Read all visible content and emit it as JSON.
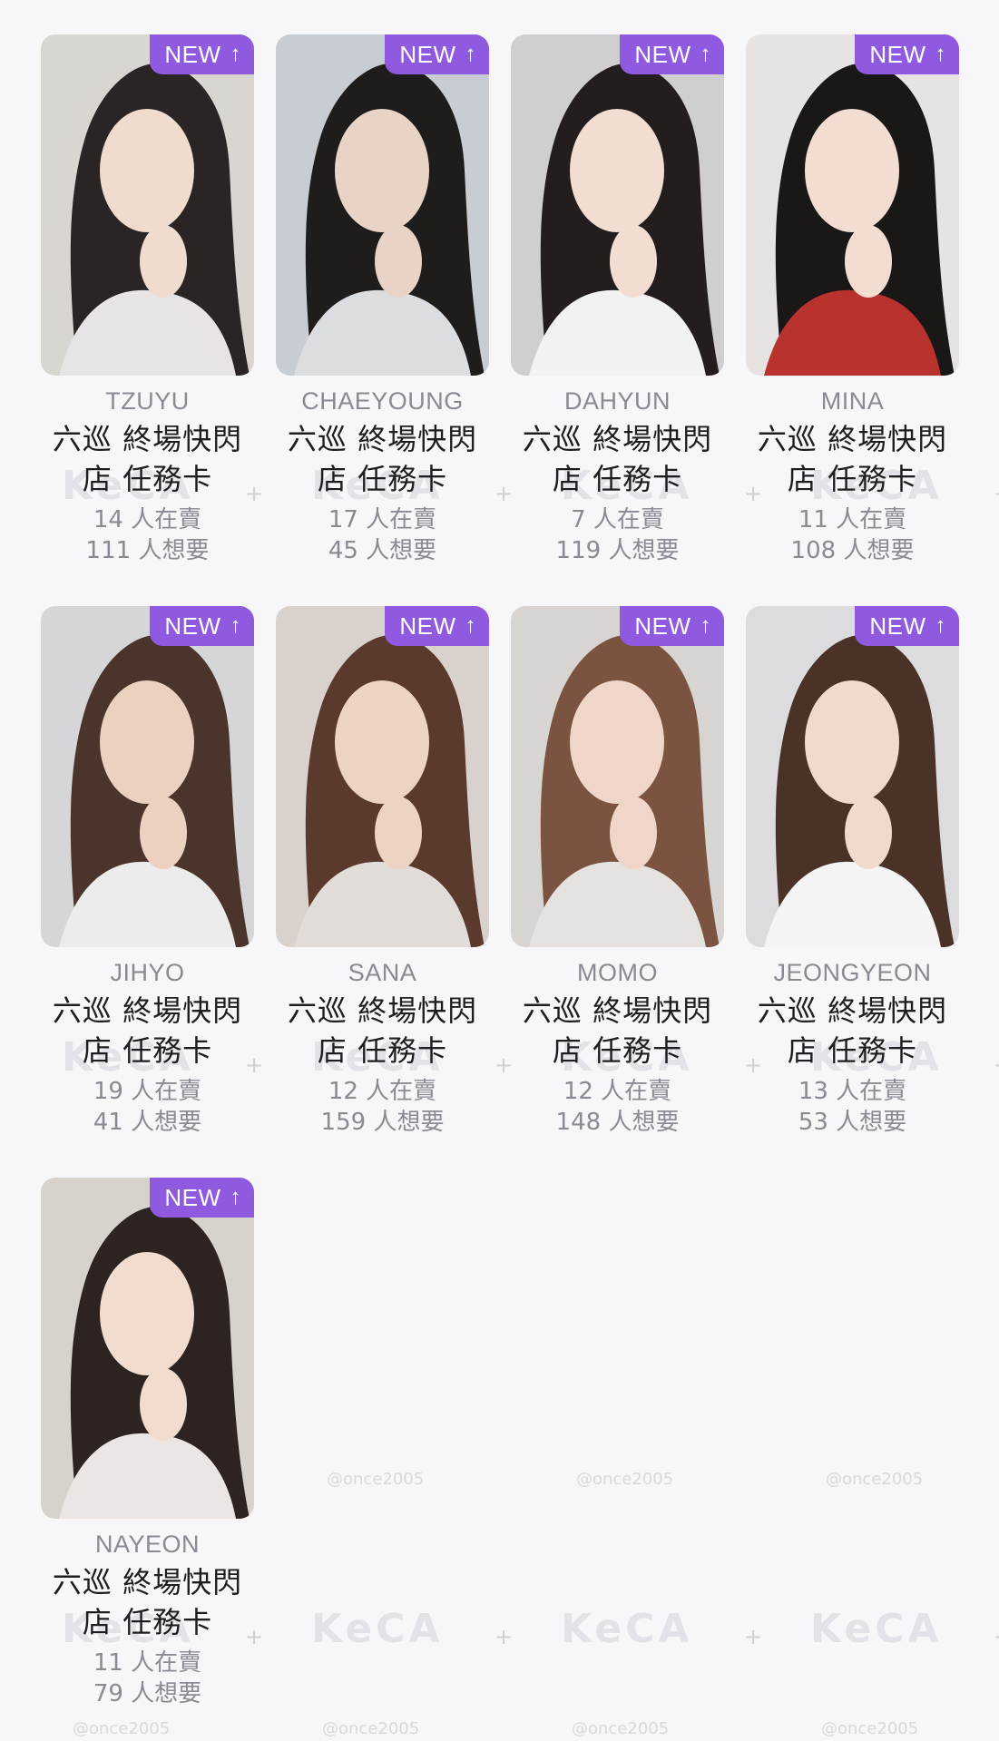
{
  "colors": {
    "background": "#f7f7f9",
    "badge": "#8f5ae0",
    "title_text": "#1e1e22",
    "muted_text": "#8a8a94"
  },
  "watermark": {
    "brand": "KeCA",
    "handle": "@once2005",
    "plus": "+"
  },
  "cards": [
    {
      "member": "TZUYU",
      "badge": "NEW",
      "badge_icon": "arrow-up-icon",
      "title": "六巡 終場快閃店 任務卡",
      "selling": "14 人在賣",
      "wanting": "111 人想要",
      "tones": [
        "#d9d6d2",
        "#2a2424",
        "#f0dccf",
        "#e8e4e6"
      ]
    },
    {
      "member": "CHAEYOUNG",
      "badge": "NEW",
      "badge_icon": "arrow-up-icon",
      "title": "六巡 終場快閃店 任務卡",
      "selling": "17 人在賣",
      "wanting": "45 人想要",
      "tones": [
        "#c8cdd3",
        "#1f1c1c",
        "#e9d2c6",
        "#dcdde0"
      ]
    },
    {
      "member": "DAHYUN",
      "badge": "NEW",
      "badge_icon": "arrow-up-icon",
      "title": "六巡 終場快閃店 任務卡",
      "selling": "7 人在賣",
      "wanting": "119 人想要",
      "tones": [
        "#cfcfcf",
        "#231d1d",
        "#f1ddd2",
        "#f2f2f2"
      ]
    },
    {
      "member": "MINA",
      "badge": "NEW",
      "badge_icon": "arrow-up-icon",
      "title": "六巡 終場快閃店 任務卡",
      "selling": "11 人在賣",
      "wanting": "108 人想要",
      "tones": [
        "#e6e3e2",
        "#1a1717",
        "#f3ddd3",
        "#b8322e"
      ]
    },
    {
      "member": "JIHYO",
      "badge": "NEW",
      "badge_icon": "arrow-up-icon",
      "title": "六巡 終場快閃店 任務卡",
      "selling": "19 人在賣",
      "wanting": "41 人想要",
      "tones": [
        "#d6d6d8",
        "#4a342b",
        "#ecd0c0",
        "#ececec"
      ]
    },
    {
      "member": "SANA",
      "badge": "NEW",
      "badge_icon": "arrow-up-icon",
      "title": "六巡 終場快閃店 任務卡",
      "selling": "12 人在賣",
      "wanting": "159 人想要",
      "tones": [
        "#d9d2cc",
        "#5a3a2c",
        "#ecd3c3",
        "#e2dcd8"
      ]
    },
    {
      "member": "MOMO",
      "badge": "NEW",
      "badge_icon": "arrow-up-icon",
      "title": "六巡 終場快閃店 任務卡",
      "selling": "12 人在賣",
      "wanting": "148 人想要",
      "tones": [
        "#d8d4d2",
        "#7a5440",
        "#efd6c8",
        "#e6e2df"
      ]
    },
    {
      "member": "JEONGYEON",
      "badge": "NEW",
      "badge_icon": "arrow-up-icon",
      "title": "六巡 終場快閃店 任務卡",
      "selling": "13 人在賣",
      "wanting": "53 人想要",
      "tones": [
        "#dcdcde",
        "#4b3228",
        "#f0d9cd",
        "#f4f4f4"
      ]
    },
    {
      "member": "NAYEON",
      "badge": "NEW",
      "badge_icon": "arrow-up-icon",
      "title": "六巡 終場快閃店 任務卡",
      "selling": "11 人在賣",
      "wanting": "79 人想要",
      "tones": [
        "#d7d3cc",
        "#2d2421",
        "#f2dbcf",
        "#ebe6e3"
      ]
    }
  ]
}
